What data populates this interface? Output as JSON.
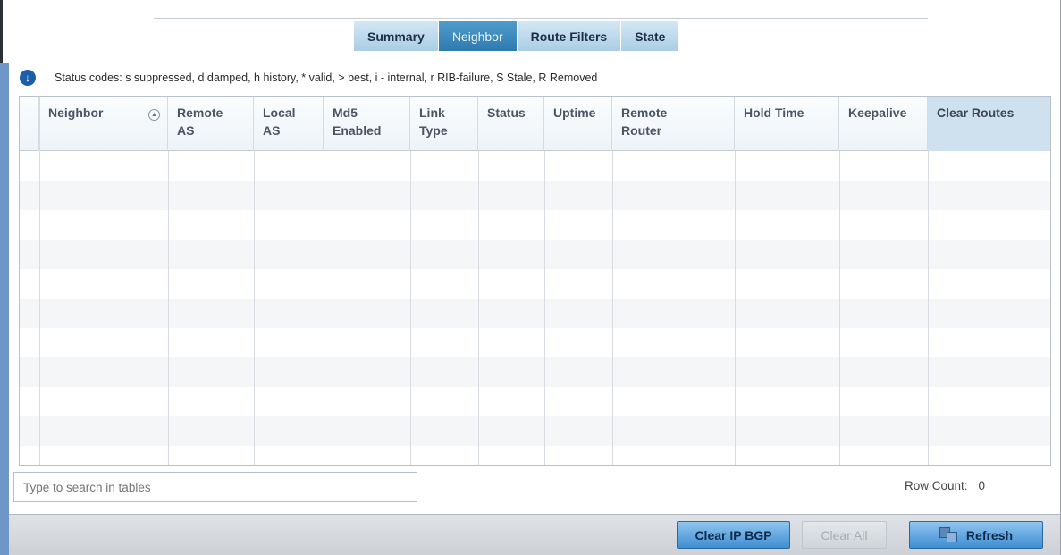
{
  "tabs": [
    {
      "label": "Summary",
      "active": false
    },
    {
      "label": "Neighbor",
      "active": true
    },
    {
      "label": "Route Filters",
      "active": false
    },
    {
      "label": "State",
      "active": false
    }
  ],
  "status": {
    "icon": "arrow-down-icon",
    "text": "Status codes: s suppressed, d damped, h history, * valid, > best, i - internal, r RIB-failure, S Stale, R Removed"
  },
  "table": {
    "columns": [
      {
        "line1": "Neighbor",
        "line2": ""
      },
      {
        "line1": "Remote",
        "line2": "AS"
      },
      {
        "line1": "Local",
        "line2": "AS"
      },
      {
        "line1": "Md5",
        "line2": "Enabled"
      },
      {
        "line1": "Link",
        "line2": "Type"
      },
      {
        "line1": "Status",
        "line2": ""
      },
      {
        "line1": "Uptime",
        "line2": ""
      },
      {
        "line1": "Remote",
        "line2": "Router"
      },
      {
        "line1": "Hold Time",
        "line2": ""
      },
      {
        "line1": "Keepalive",
        "line2": ""
      },
      {
        "line1": "Clear Routes",
        "line2": ""
      }
    ],
    "rows": []
  },
  "search": {
    "placeholder": "Type to search in tables"
  },
  "row_count": {
    "label": "Row Count:",
    "value": "0"
  },
  "buttons": {
    "clear_ip_bgp": "Clear IP BGP",
    "clear_all": "Clear All",
    "refresh": "Refresh"
  }
}
